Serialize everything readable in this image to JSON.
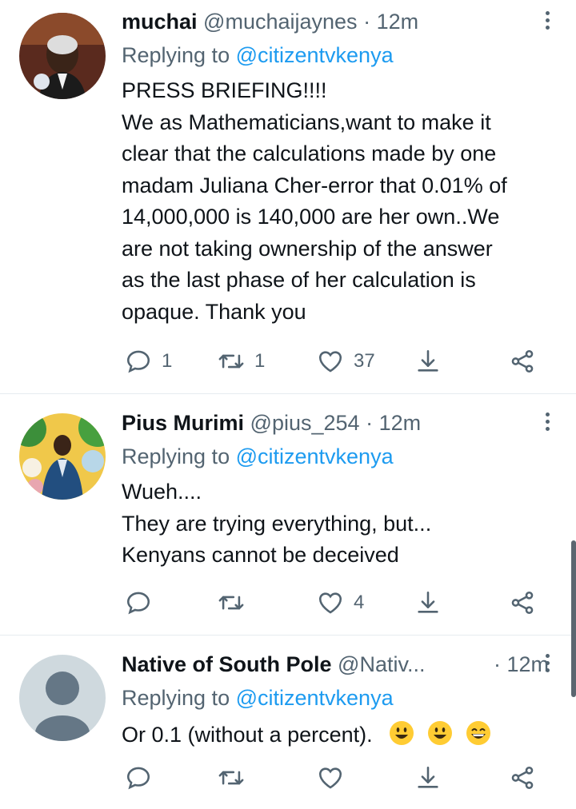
{
  "tweets": [
    {
      "name": "muchai",
      "handle": "@muchaijaynes",
      "time": "12m",
      "reply_prefix": "Replying to ",
      "reply_to": "@citizentvkenya",
      "lines": [
        "PRESS BRIEFING!!!!",
        "We as Mathematicians,want to make it",
        "clear that the calculations made by one",
        "madam Juliana Cher-error that 0.01% of",
        "14,000,000 is 140,000 are her own..We",
        "are not taking ownership of the answer",
        "as the last phase of her calculation is",
        "opaque. Thank you"
      ],
      "replies": "1",
      "retweets": "1",
      "likes": "37"
    },
    {
      "name": "Pius Murimi",
      "handle": "@pius_254",
      "time": "12m",
      "reply_prefix": "Replying to ",
      "reply_to": "@citizentvkenya",
      "lines": [
        "Wueh....",
        "They are trying everything, but...",
        "Kenyans cannot be deceived"
      ],
      "replies": "",
      "retweets": "",
      "likes": "4"
    },
    {
      "name": "Native of South Pole",
      "handle": "@Nativ...",
      "time": "12m",
      "reply_prefix": "Replying to ",
      "reply_to": "@citizentvkenya",
      "text": "Or 0.1 (without a percent).",
      "replies": "",
      "retweets": "",
      "likes": ""
    }
  ],
  "separator": "·",
  "icons": {
    "reply": "reply-icon",
    "retweet": "retweet-icon",
    "like": "heart-icon",
    "bookmark": "bookmark-icon",
    "share": "share-icon",
    "more": "more-vertical-icon"
  },
  "colors": {
    "link": "#1d9bf0",
    "muted": "#536471",
    "text": "#0f1419"
  }
}
